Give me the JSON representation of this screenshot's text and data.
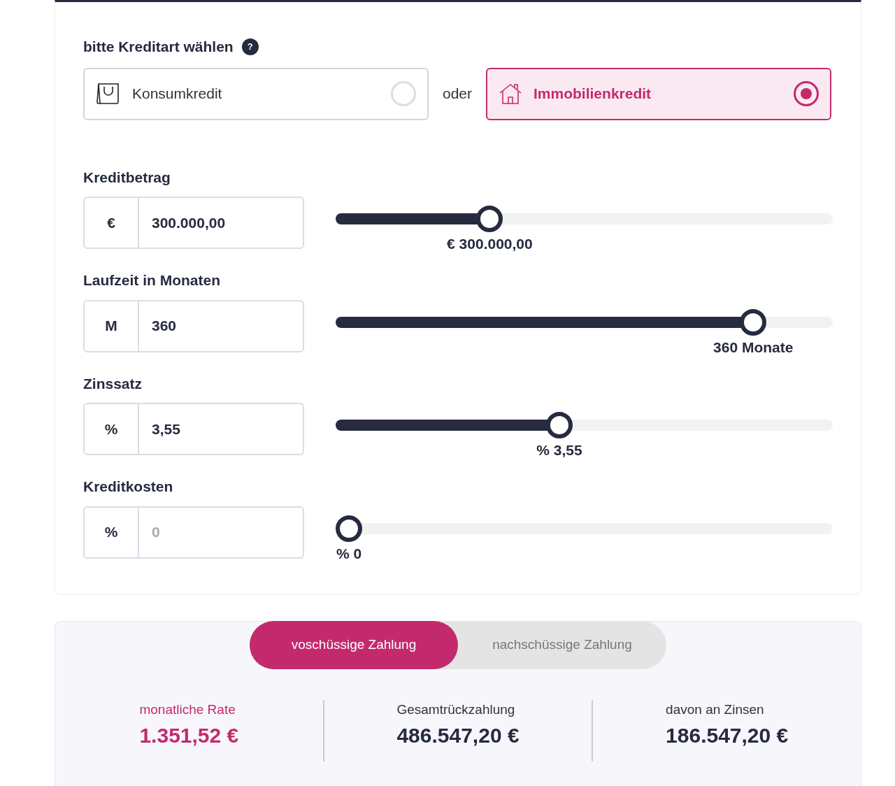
{
  "credit_type": {
    "label": "bitte Kreditart wählen",
    "help": "?",
    "separator": "oder",
    "options": [
      {
        "label": "Konsumkredit",
        "kind": "bag",
        "selected": false
      },
      {
        "label": "Immobilienkredit",
        "kind": "house",
        "selected": true
      }
    ]
  },
  "fields": [
    {
      "label": "Kreditbetrag",
      "unit": "€",
      "value": "300.000,00",
      "level": 0.31,
      "reading": "€ 300.000,00"
    },
    {
      "label": "Laufzeit in Monaten",
      "unit": "M",
      "value": "360",
      "level": 0.84,
      "reading": "360 Monate"
    },
    {
      "label": "Zinssatz",
      "unit": "%",
      "value": "3,55",
      "level": 0.45,
      "reading": "% 3,55"
    },
    {
      "label": "Kreditkosten",
      "unit": "%",
      "placeholder": "0",
      "level": 0,
      "reading": "% 0"
    }
  ],
  "payment_toggle": [
    {
      "label": "voschüssige Zahlung",
      "selected": true
    },
    {
      "label": "nachschüssige Zahlung",
      "selected": false
    }
  ],
  "results": [
    {
      "label": "monatliche Rate",
      "value": "1.351,52 €",
      "highlight": true
    },
    {
      "label": "Gesamtrückzahlung",
      "value": "486.547,20 €",
      "highlight": false
    },
    {
      "label": "davon an Zinsen",
      "value": "186.547,20 €",
      "highlight": false
    }
  ]
}
